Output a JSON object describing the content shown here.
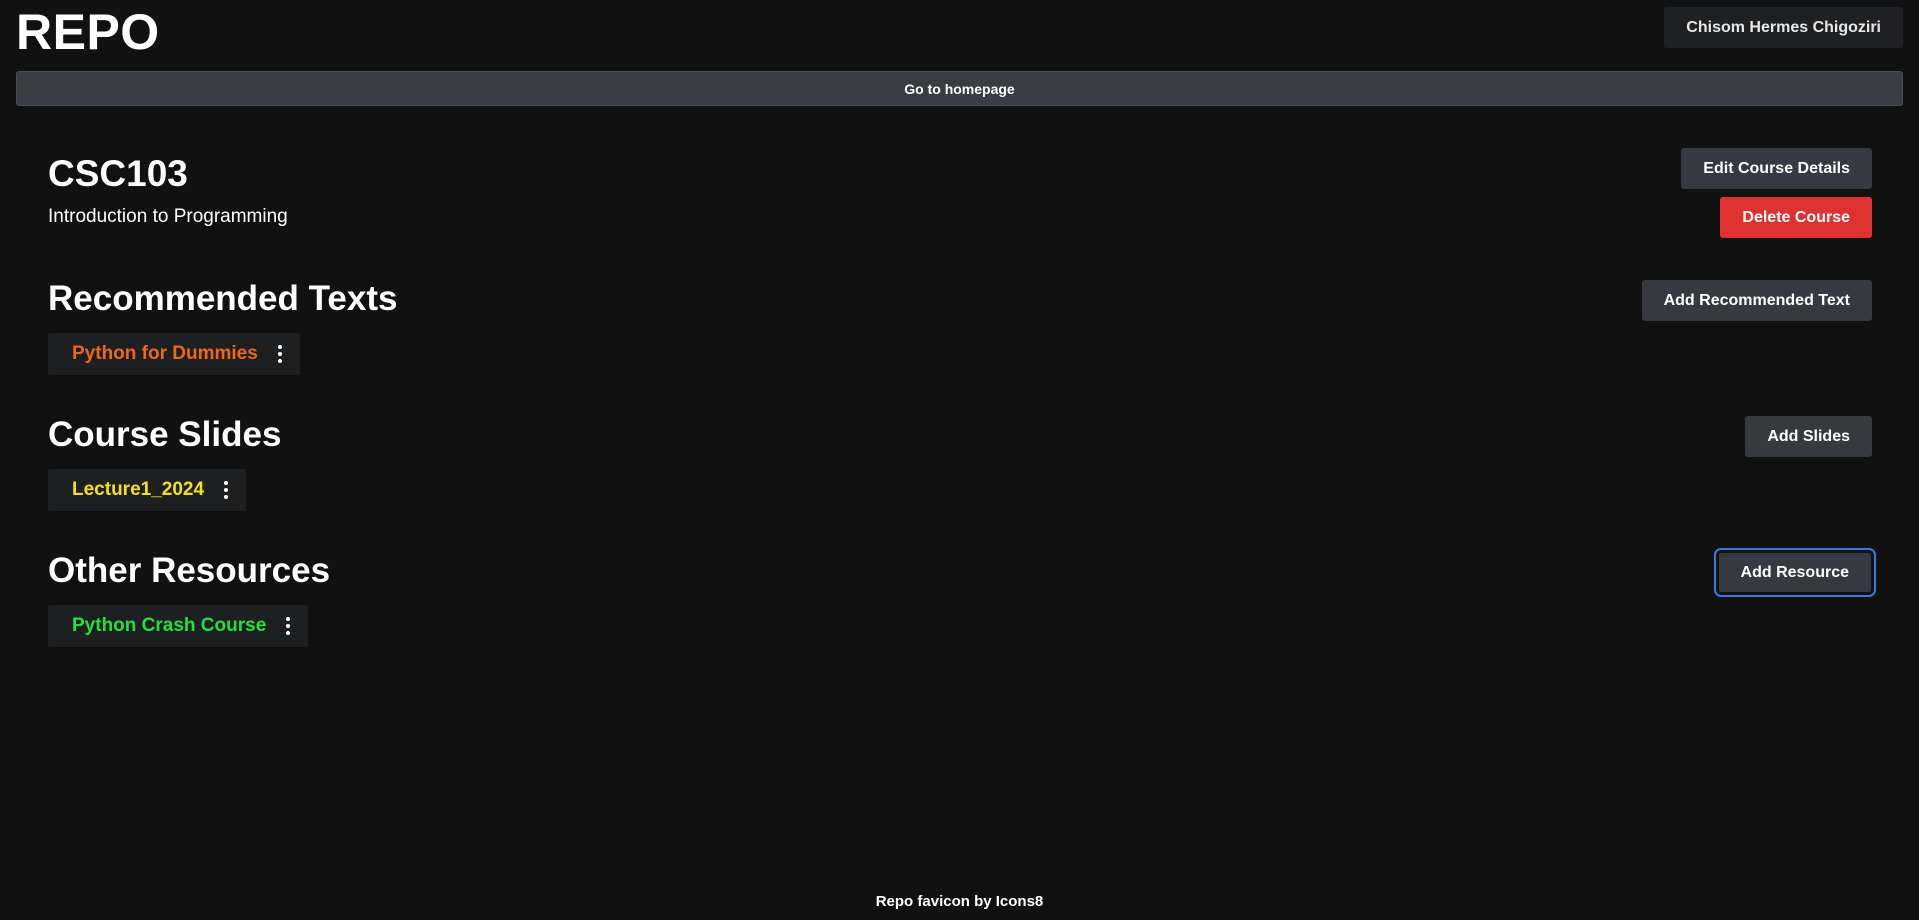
{
  "header": {
    "logo": "REPO",
    "user_name": "Chisom Hermes Chigoziri"
  },
  "nav": {
    "home_label": "Go to homepage"
  },
  "course": {
    "code": "CSC103",
    "name": "Introduction to Programming",
    "edit_label": "Edit Course Details",
    "delete_label": "Delete Course"
  },
  "sections": {
    "texts": {
      "title": "Recommended Texts",
      "add_label": "Add Recommended Text",
      "items": [
        {
          "label": "Python for Dummies",
          "color": "#f0661d"
        }
      ]
    },
    "slides": {
      "title": "Course Slides",
      "add_label": "Add Slides",
      "items": [
        {
          "label": "Lecture1_2024",
          "color": "#f2e21a"
        }
      ]
    },
    "resources": {
      "title": "Other Resources",
      "add_label": "Add Resource",
      "items": [
        {
          "label": "Python Crash Course",
          "color": "#21e23a"
        }
      ]
    }
  },
  "footer": {
    "credit": "Repo favicon by Icons8"
  },
  "icons": {
    "more": "more-vertical-icon"
  },
  "colors": {
    "background": "#111111",
    "danger": "#e03131",
    "button": "#363940",
    "focus": "#2f7de1"
  }
}
